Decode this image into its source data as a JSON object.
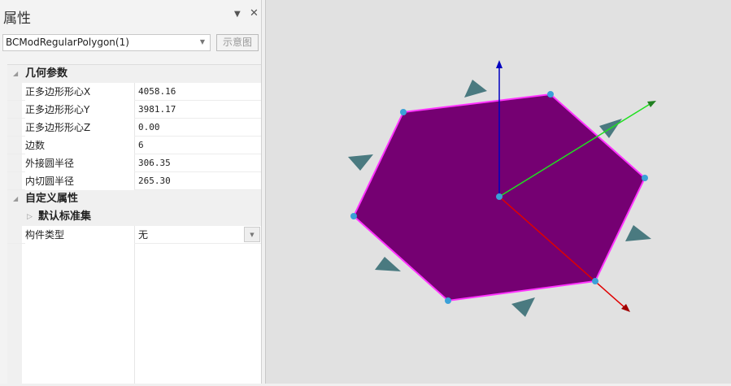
{
  "panel": {
    "title": "属性",
    "combo_value": "BCModRegularPolygon(1)",
    "schematic_button": "示意图"
  },
  "grid": {
    "categories": [
      {
        "label": "几何参数"
      },
      {
        "label": "自定义属性"
      },
      {
        "label": "默认标准集"
      }
    ],
    "props": [
      {
        "key": "正多边形形心X",
        "value": "4058.16"
      },
      {
        "key": "正多边形形心Y",
        "value": "3981.17"
      },
      {
        "key": "正多边形形心Z",
        "value": "0.00"
      },
      {
        "key": "边数",
        "value": "6"
      },
      {
        "key": "外接圆半径",
        "value": "306.35"
      },
      {
        "key": "内切圆半径",
        "value": "265.30"
      },
      {
        "key": "构件类型",
        "value": "无"
      }
    ]
  },
  "viewport": {
    "fill": "#750072",
    "edge": "#ff33ff",
    "vertex": "#3aa0d8",
    "x_axis": "#e00000",
    "y_axis": "#20e020",
    "z_axis": "#0000c0",
    "marker": "#4a7a80"
  }
}
